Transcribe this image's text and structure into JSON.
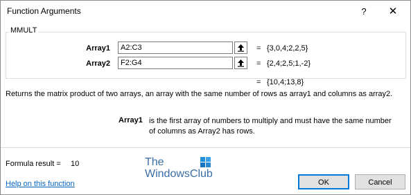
{
  "window": {
    "title": "Function Arguments",
    "help_glyph": "?",
    "close_glyph": "✕"
  },
  "function": {
    "name": "MMULT",
    "args": [
      {
        "label": "Array1",
        "value": "A2:C3",
        "equals": "=",
        "evaluated": "{3,0,4;2,2,5}"
      },
      {
        "label": "Array2",
        "value": "F2:G4",
        "equals": "=",
        "evaluated": "{2,4;2,5;1,-2}"
      }
    ],
    "result_equals": "=",
    "result_preview": "{10,4;13,8}",
    "description": "Returns the matrix product of two arrays, an array with the same number of rows as array1 and columns as array2.",
    "arg_help_label": "Array1",
    "arg_help_text": "is the first array of numbers to multiply and must have the same number of columns as Array2 has rows."
  },
  "footer": {
    "formula_result_label": "Formula result =",
    "formula_result_value": "10",
    "help_link": "Help on this function",
    "ok_label": "OK",
    "cancel_label": "Cancel"
  },
  "watermark": {
    "line1": "The",
    "line2": "WindowsClub"
  },
  "colors": {
    "link": "#0563c1",
    "ok_border": "#0078d7",
    "logo": "#3a6ea5"
  }
}
